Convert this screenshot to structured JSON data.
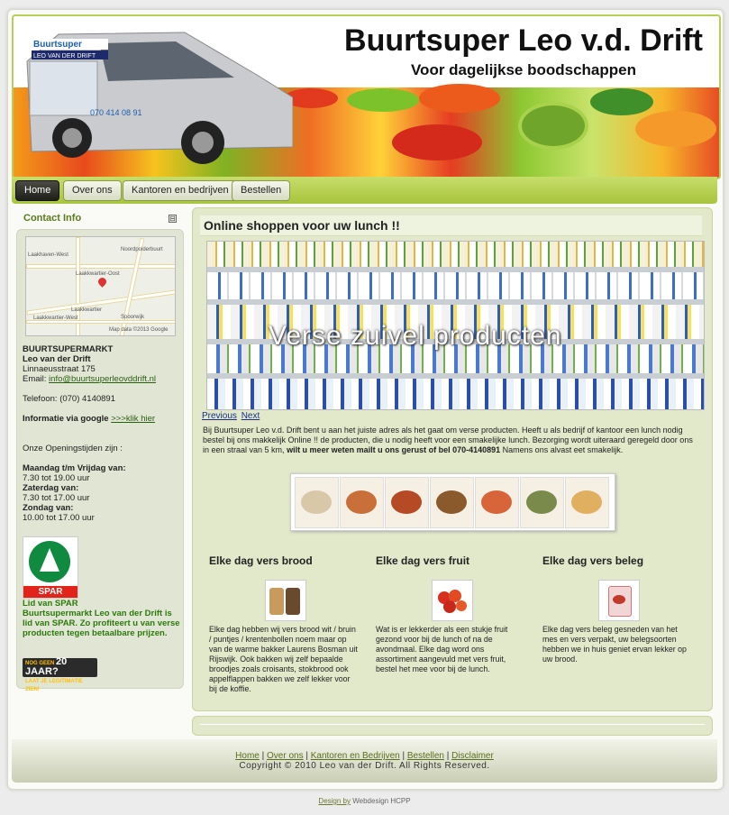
{
  "header": {
    "title": "Buurtsuper Leo v.d. Drift",
    "subtitle": "Voor dagelijkse boodschappen",
    "van_text": "Buurtsuper",
    "van_text2": "LEO VAN DER DRIFT",
    "van_phone": "070 414 08 91"
  },
  "nav": {
    "items": [
      "Home",
      "Over ons",
      "Kantoren en bedrijven",
      "Bestellen"
    ]
  },
  "sidebar": {
    "title": "Contact Info",
    "map_labels": [
      "Noordpolderbuurt",
      "Laakhaven-West",
      "Laakkwartier-Oost",
      "Laakkwartier",
      "Laakkwartier-West",
      "Map data ©2013 Google",
      "Spoorwijk"
    ],
    "shop_name": "BUURTSUPERMARKT",
    "owner": "Leo van der Drift",
    "address": "Linnaeusstraat 175",
    "email_label": "Email:",
    "email": "info@buurtsuperleovddrift.nl",
    "phone": "Telefoon: (070) 4140891",
    "google_label": "Informatie via google",
    "google_link": ">>>klik hier",
    "hours_title": "Onze Openingstijden zijn :",
    "hours": [
      {
        "day": "Maandag t/m Vrijdag van:",
        "time": "7.30 tot 19.00 uur"
      },
      {
        "day": "Zaterdag van:",
        "time": "7.30 tot 17.00 uur"
      },
      {
        "day": "Zondag van:",
        "time": "10.00 tot 17.00 uur"
      }
    ],
    "spar_logo_text": "SPAR",
    "spar_title": "Lid van SPAR",
    "spar_text": "Buurtsupermarkt Leo van der Drift is lid van SPAR. Zo profiteert u van verse producten tegen betaalbare prijzen.",
    "age_badge_top": "NOG GEEN",
    "age_badge_num": "20 JAAR?",
    "age_badge_bottom": "LAAT JE LEGITIMATIE ZIEN!"
  },
  "main": {
    "heading": "Online shoppen voor uw lunch !!",
    "slide_caption": "Verse zuivel producten",
    "prev": "Previous",
    "next": "Next",
    "intro_1": "Bij Buurtsuper Leo v.d. Drift bent u aan het juiste adres als het gaat om verse producten. Heeft u als bedrijf of kantoor een lunch nodig bestel bij ons makkelijk Online !! de producten, die u nodig heeft voor een smakelijke lunch. Bezorging wordt uiteraard geregeld door ons in een straal van 5 km,",
    "intro_bold": "wilt u meer weten mailt u ons gerust of bel 070-4140891",
    "intro_2": "Namens ons alvast eet smakelijk.",
    "columns": [
      {
        "title": "Elke dag vers brood",
        "text": "Elke dag hebben wij vers brood wit / bruin / puntjes / krentenbollen noem maar op van de warme bakker Laurens Bosman uit Rijswijk. Ook bakken wij zelf bepaalde broodjes zoals croisants, stokbrood ook appelflappen bakken we zelf lekker voor bij de koffie."
      },
      {
        "title": "Elke dag vers fruit",
        "text": "Wat is er lekkerder als een stukje fruit gezond voor bij de lunch of na de avondmaal. Elke dag word ons assortiment aangevuld met vers fruit, bestel het mee voor bij de lunch."
      },
      {
        "title": "Elke dag vers beleg",
        "text": "Elke dag vers beleg gesneden van het mes en vers verpakt, uw belegsoorten hebben we in huis geniet ervan lekker op uw brood."
      }
    ]
  },
  "footer": {
    "links": [
      "Home",
      "Over ons",
      "Kantoren en Bedrijven",
      "Bestellen",
      "Disclaimer"
    ],
    "separator": " | ",
    "copyright": "Copyright © 2010 Leo van der Drift. All Rights Reserved.",
    "design_by": "Design by",
    "designer": "Webdesign HCPP"
  },
  "colors": {
    "accent_green": "#b7cf58",
    "panel_bg": "#e1e9ca",
    "spar_green": "#0f8a3f",
    "spar_red": "#e2231a",
    "link_green": "#2b7a0b"
  }
}
